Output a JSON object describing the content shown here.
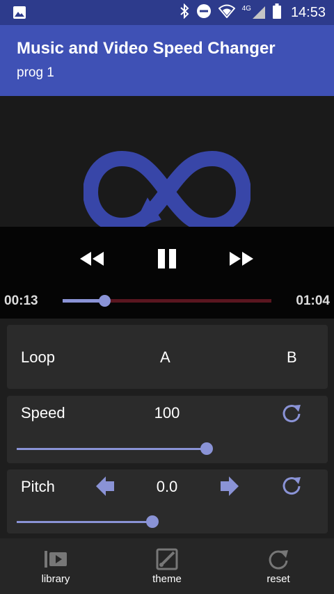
{
  "status_bar": {
    "time": "14:53",
    "network": "4G",
    "icons": [
      "image-icon",
      "bluetooth-icon",
      "do-not-disturb-icon",
      "wifi-icon",
      "signal-icon",
      "battery-icon"
    ]
  },
  "app_bar": {
    "title": "Music and Video Speed Changer",
    "subtitle": "prog 1"
  },
  "player": {
    "current_time": "00:13",
    "total_time": "01:04",
    "progress": 0.2
  },
  "loop": {
    "label": "Loop",
    "a_label": "A",
    "b_label": "B"
  },
  "speed": {
    "label": "Speed",
    "value": "100",
    "level": 0.7
  },
  "pitch": {
    "label": "Pitch",
    "value": "0.0",
    "level": 0.5
  },
  "bottom_nav": {
    "items": [
      {
        "label": "library",
        "icon": "library-icon"
      },
      {
        "label": "theme",
        "icon": "theme-icon"
      },
      {
        "label": "reset",
        "icon": "reset-icon"
      }
    ]
  },
  "colors": {
    "primary": "#3f51b5",
    "primary_dark": "#2d3b8c",
    "accent": "#8a93d6",
    "track_remaining": "#5a1620"
  }
}
